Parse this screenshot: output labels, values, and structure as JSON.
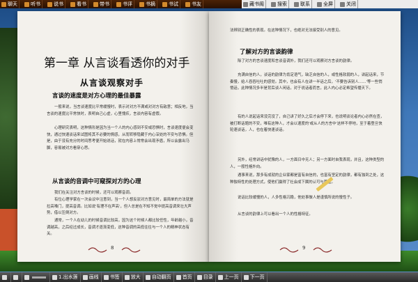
{
  "toolbar": {
    "left_items": [
      {
        "label": "聊天",
        "icon": "chat-icon"
      },
      {
        "label": "听书",
        "icon": "headphones-icon"
      },
      {
        "label": "说书",
        "icon": "speech-icon"
      },
      {
        "label": "看书",
        "icon": "book-icon"
      },
      {
        "label": "带书",
        "icon": "bag-icon"
      },
      {
        "label": "书评",
        "icon": "comment-icon"
      },
      {
        "label": "书摘",
        "icon": "excerpt-icon"
      },
      {
        "label": "书试",
        "icon": "test-icon"
      },
      {
        "label": "书友",
        "icon": "friends-icon"
      }
    ],
    "right_items": [
      {
        "label": "藏书阁",
        "icon": "library-icon"
      },
      {
        "label": "搜索",
        "icon": "search-icon"
      },
      {
        "label": "联系",
        "icon": "contact-icon"
      },
      {
        "label": "全屏",
        "icon": "fullscreen-icon"
      },
      {
        "label": "关闭",
        "icon": "close-icon"
      }
    ]
  },
  "book": {
    "left_page": {
      "chapter_title": "第一章 从言谈看透你的对手",
      "subtitle": "从言谈观察对手",
      "section1": "言谈的速度是对方心理的最佳暴露",
      "paras1": [
        "一般来说，当言谈速度比平常缓慢时，表示对对方不满或对对方有敌意；相反地，当言谈的速度比平常快时，表明自己心虚，心里愧疚，言谈内容有虚假。",
        "心理研究表明，这种情形是因为当一个人的内心感到不安或恐惧时，言谈速度便会变快，通过快速谈话来试图将其不必要的情感，从而转移隐藏于内心深处的不安与恐惧。但是，由于没有充分的时间思考便开始说话，就在内容上常常会出现矛盾，所以会露出马脚，容易被对方看穿心思。"
      ],
      "section2": "从言谈的音调中可窥探对方的心理",
      "paras2": [
        "我们在关注对方言谈的时候，还可以观察音调。",
        "有位心理学家在一次会议中注意到，当一个人想反驳对方意见时，最简单的方法就是拉高嗓门，提高音调。比如说'有理不在声高'，但人总是在不知不觉中提高音调来壮大声势，借以压倒对方。",
        "通常，一个人在幼儿的时候音调比较高，因为这个时候人都比较任性，年龄越小，音调越高，之后经过成长，音调才逐渐变低，这种音调的高低往往与一个人的精神状态有关。"
      ],
      "page_number": "8"
    },
    "right_page": {
      "para_top": "法辨别正确性的表现。在这种情况下，也绝对无法接受别人的意见。",
      "section": "了解对方的言谈韵律",
      "paras": [
        "除了对方的言谈速度和言谈音调外，我们还可以观察对方言谈的韵律。",
        "充满自信的人，谈话的韵律为肯定语气，缺乏自信的人，或性格软弱的人，讲起话来，节奏慢，给人吞吞吐吐的感觉。其中，也会有人在讲一半话之后，'不要告诉别人……'等一些悄悄话，此种情况多半是背后谈人闲话，对于说话者而言，此人内心必定希望传播天下。",
        "有的人说起话来没完没了，自己讲了好久之后才会停下来，也说明谈论者内心必然在查，被打断话题的不安，唯有这种人，才会以速度的'或从人的方言中'这样不停地，至于着登旦快轮速谈话，人，也在着快速谈话。",
        "另外，经常讲话中犹豫的人，一方面日中无人；另一方面时自我表现，并且，这种类型的人，一般性格外向。",
        "遇事来说，那多有成就的企业家都是富有自信的，也富有坚定的韵律，都有独到之处，这种独特性的处理方式，使他们赢得了社会成下属的认可与尊重。",
        "说话比较缓慢的人，人多性格沉稳，他处事做人是谨慎所说的慢性子。",
        "从言谈的韵律上可以看出一个人的性格特征。"
      ],
      "page_number": "9"
    }
  },
  "bottombar": {
    "items": [
      {
        "label": "",
        "icon": "prev-icon"
      },
      {
        "label": "",
        "icon": "play-icon"
      },
      {
        "label": "",
        "icon": "volume-icon"
      },
      {
        "label": "1.出水莲",
        "icon": "music-icon"
      },
      {
        "label": "画线",
        "icon": "draw-icon"
      },
      {
        "label": "书签",
        "icon": "bookmark-icon"
      },
      {
        "label": "放大",
        "icon": "zoom-in-icon"
      },
      {
        "label": "自动翻页",
        "icon": "autoflip-icon"
      },
      {
        "label": "首页",
        "icon": "first-page-icon"
      },
      {
        "label": "目录",
        "icon": "toc-icon"
      },
      {
        "label": "上一页",
        "icon": "prev-page-icon"
      },
      {
        "label": "下一页",
        "icon": "next-page-icon"
      }
    ]
  },
  "colors": {
    "toolbar_bg": "#3a1803",
    "page_bg": "#f3f1ec",
    "sky": "#3f78b9",
    "grass": "#3e8b2b"
  }
}
